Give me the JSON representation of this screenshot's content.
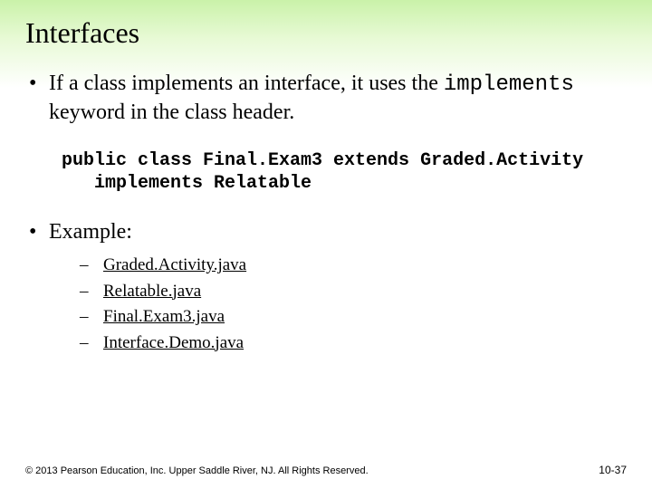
{
  "title": "Interfaces",
  "bullets": [
    {
      "pre": "If a class implements an interface, it uses the ",
      "kw": "implements",
      "post": " keyword in the class header."
    },
    {
      "plain": "Example:"
    }
  ],
  "code": "public class Final.Exam3 extends Graded.Activity\n   implements Relatable",
  "links": [
    "Graded.Activity.java",
    "Relatable.java",
    "Final.Exam3.java",
    "Interface.Demo.java"
  ],
  "footer": "© 2013 Pearson Education, Inc. Upper Saddle River, NJ. All Rights Reserved.",
  "pagenum": "10-37"
}
